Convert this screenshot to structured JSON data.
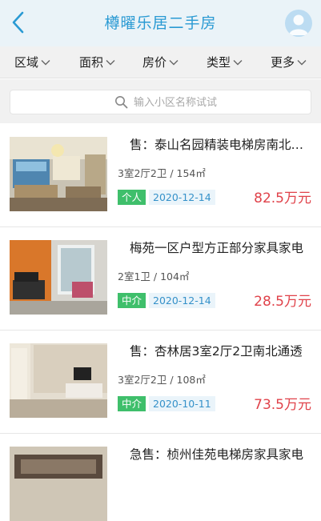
{
  "header": {
    "title": "樽曜乐居二手房",
    "back_icon": "chevron-left-icon",
    "avatar_icon": "user-avatar-icon",
    "accent": "#2a9ad3"
  },
  "filters": [
    {
      "label": "区域"
    },
    {
      "label": "面积"
    },
    {
      "label": "房价"
    },
    {
      "label": "类型"
    },
    {
      "label": "更多"
    }
  ],
  "search": {
    "placeholder": "输入小区名称试试",
    "icon": "search-icon"
  },
  "listings": [
    {
      "title": "售：泰山名园精装电梯房南北通透",
      "spec": "3室2厅2卫 / 154㎡",
      "badge": "个人",
      "date": "2020-12-14",
      "price": "82.5万元"
    },
    {
      "title": "梅苑一区户型方正部分家具家电",
      "spec": "2室1卫 / 104㎡",
      "badge": "中介",
      "date": "2020-12-14",
      "price": "28.5万元"
    },
    {
      "title": "售：杏林居3室2厅2卫南北通透",
      "spec": "3室2厅2卫 / 108㎡",
      "badge": "中介",
      "date": "2020-10-11",
      "price": "73.5万元"
    },
    {
      "title": "急售：桢州佳苑电梯房家具家电",
      "spec": "",
      "badge": "",
      "date": "",
      "price": ""
    }
  ],
  "colors": {
    "badge_green": "#3fbf6b",
    "price_red": "#e0424a",
    "date_blue": "#3591c9"
  }
}
